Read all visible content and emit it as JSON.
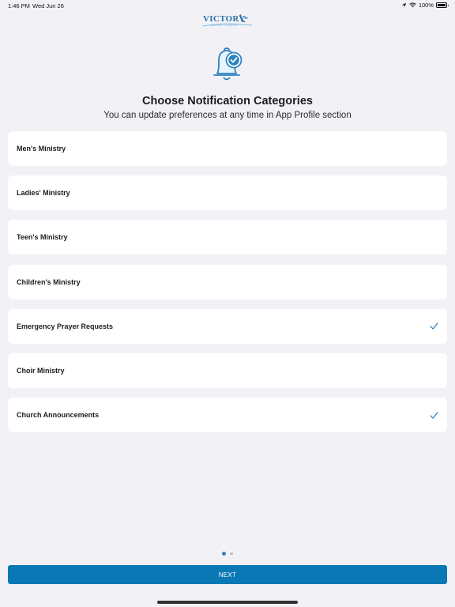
{
  "status_bar": {
    "time": "1:46 PM",
    "date": "Wed Jun 26",
    "battery_percent": "100%",
    "icons": [
      "location-icon",
      "wifi-icon",
      "battery-icon"
    ]
  },
  "header": {
    "logo_text": "Victory",
    "logo_subtext": "BAPTIST CHURCH"
  },
  "hero": {
    "icon": "bell-check-icon",
    "title": "Choose Notification Categories",
    "subtitle": "You can update preferences at any time in App Profile section"
  },
  "categories": [
    {
      "label": "Men's Ministry",
      "checked": false
    },
    {
      "label": "Ladies' Ministry",
      "checked": false
    },
    {
      "label": "Teen's Ministry",
      "checked": false
    },
    {
      "label": "Children's Ministry",
      "checked": false
    },
    {
      "label": "Emergency Prayer Requests",
      "checked": true
    },
    {
      "label": "Choir Ministry",
      "checked": false
    },
    {
      "label": "Church Announcements",
      "checked": true
    }
  ],
  "pager": {
    "current_page": 1,
    "total_pages": 2
  },
  "next_button": {
    "label": "NEXT"
  },
  "colors": {
    "background": "#f2f2f6",
    "accent": "#0a78b4",
    "check": "#2d82c0",
    "card": "#ffffff"
  }
}
